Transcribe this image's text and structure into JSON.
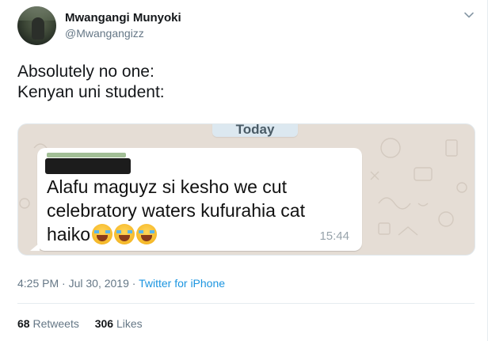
{
  "author": {
    "display_name": "Mwangangi Munyoki",
    "handle": "@Mwangangizz"
  },
  "tweet": {
    "lines": [
      "Absolutely no one:",
      "Kenyan uni student:"
    ]
  },
  "media": {
    "date_pill": "Today",
    "message_lines": [
      "Alafu maguyz si kesho we cut",
      "celebratory waters kufurahia cat",
      "haiko"
    ],
    "emoji": [
      "face-with-tears-of-joy",
      "face-with-tears-of-joy",
      "face-with-tears-of-joy"
    ],
    "time": "15:44",
    "colors": {
      "chat_bg": "#e5ddd5",
      "bubble": "#ffffff",
      "date_pill": "#dce8f0"
    }
  },
  "meta": {
    "time": "4:25 PM",
    "separator": "·",
    "date": "Jul 30, 2019",
    "source": "Twitter for iPhone"
  },
  "stats": {
    "retweets_count": "68",
    "retweets_label": "Retweets",
    "likes_count": "306",
    "likes_label": "Likes"
  },
  "colors": {
    "link": "#1b95e0",
    "secondary_text": "#657786",
    "primary_text": "#14171a"
  },
  "icons": {
    "menu_caret": "chevron-down-icon"
  }
}
